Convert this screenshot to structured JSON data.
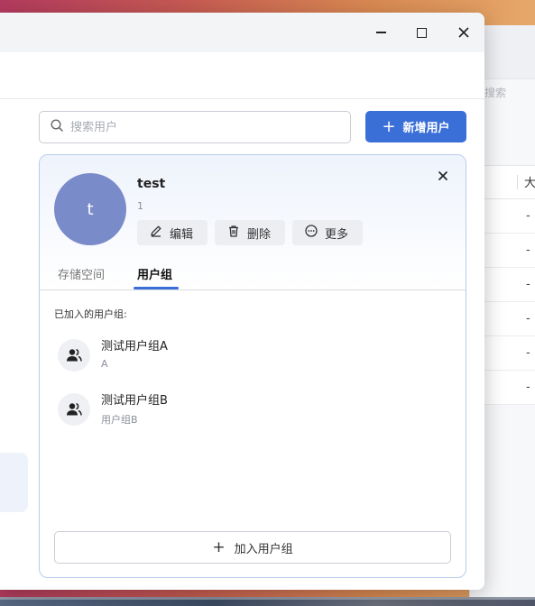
{
  "background": {
    "search_label": "搜索",
    "column_header": "大",
    "row_values": [
      "-",
      "-",
      "-",
      "-",
      "-",
      "-"
    ]
  },
  "window": {
    "controls": {
      "minimize": "minimize-icon",
      "maximize": "maximize-icon",
      "close": "close-icon"
    }
  },
  "search": {
    "placeholder": "搜索用户",
    "value": ""
  },
  "toolbar": {
    "add_user_label": "新增用户",
    "accent": "#3b6fd8"
  },
  "user": {
    "avatar_letter": "t",
    "avatar_color": "#7a8bc9",
    "name": "test",
    "id": "1",
    "actions": {
      "edit": "编辑",
      "delete": "删除",
      "more": "更多"
    }
  },
  "tabs": [
    {
      "label": "存储空间",
      "active": false
    },
    {
      "label": "用户组",
      "active": true
    }
  ],
  "groups_section": {
    "title": "已加入的用户组:",
    "items": [
      {
        "name": "测试用户组A",
        "description": "A"
      },
      {
        "name": "测试用户组B",
        "description": "用户组B"
      }
    ],
    "join_button_label": "加入用户组"
  }
}
